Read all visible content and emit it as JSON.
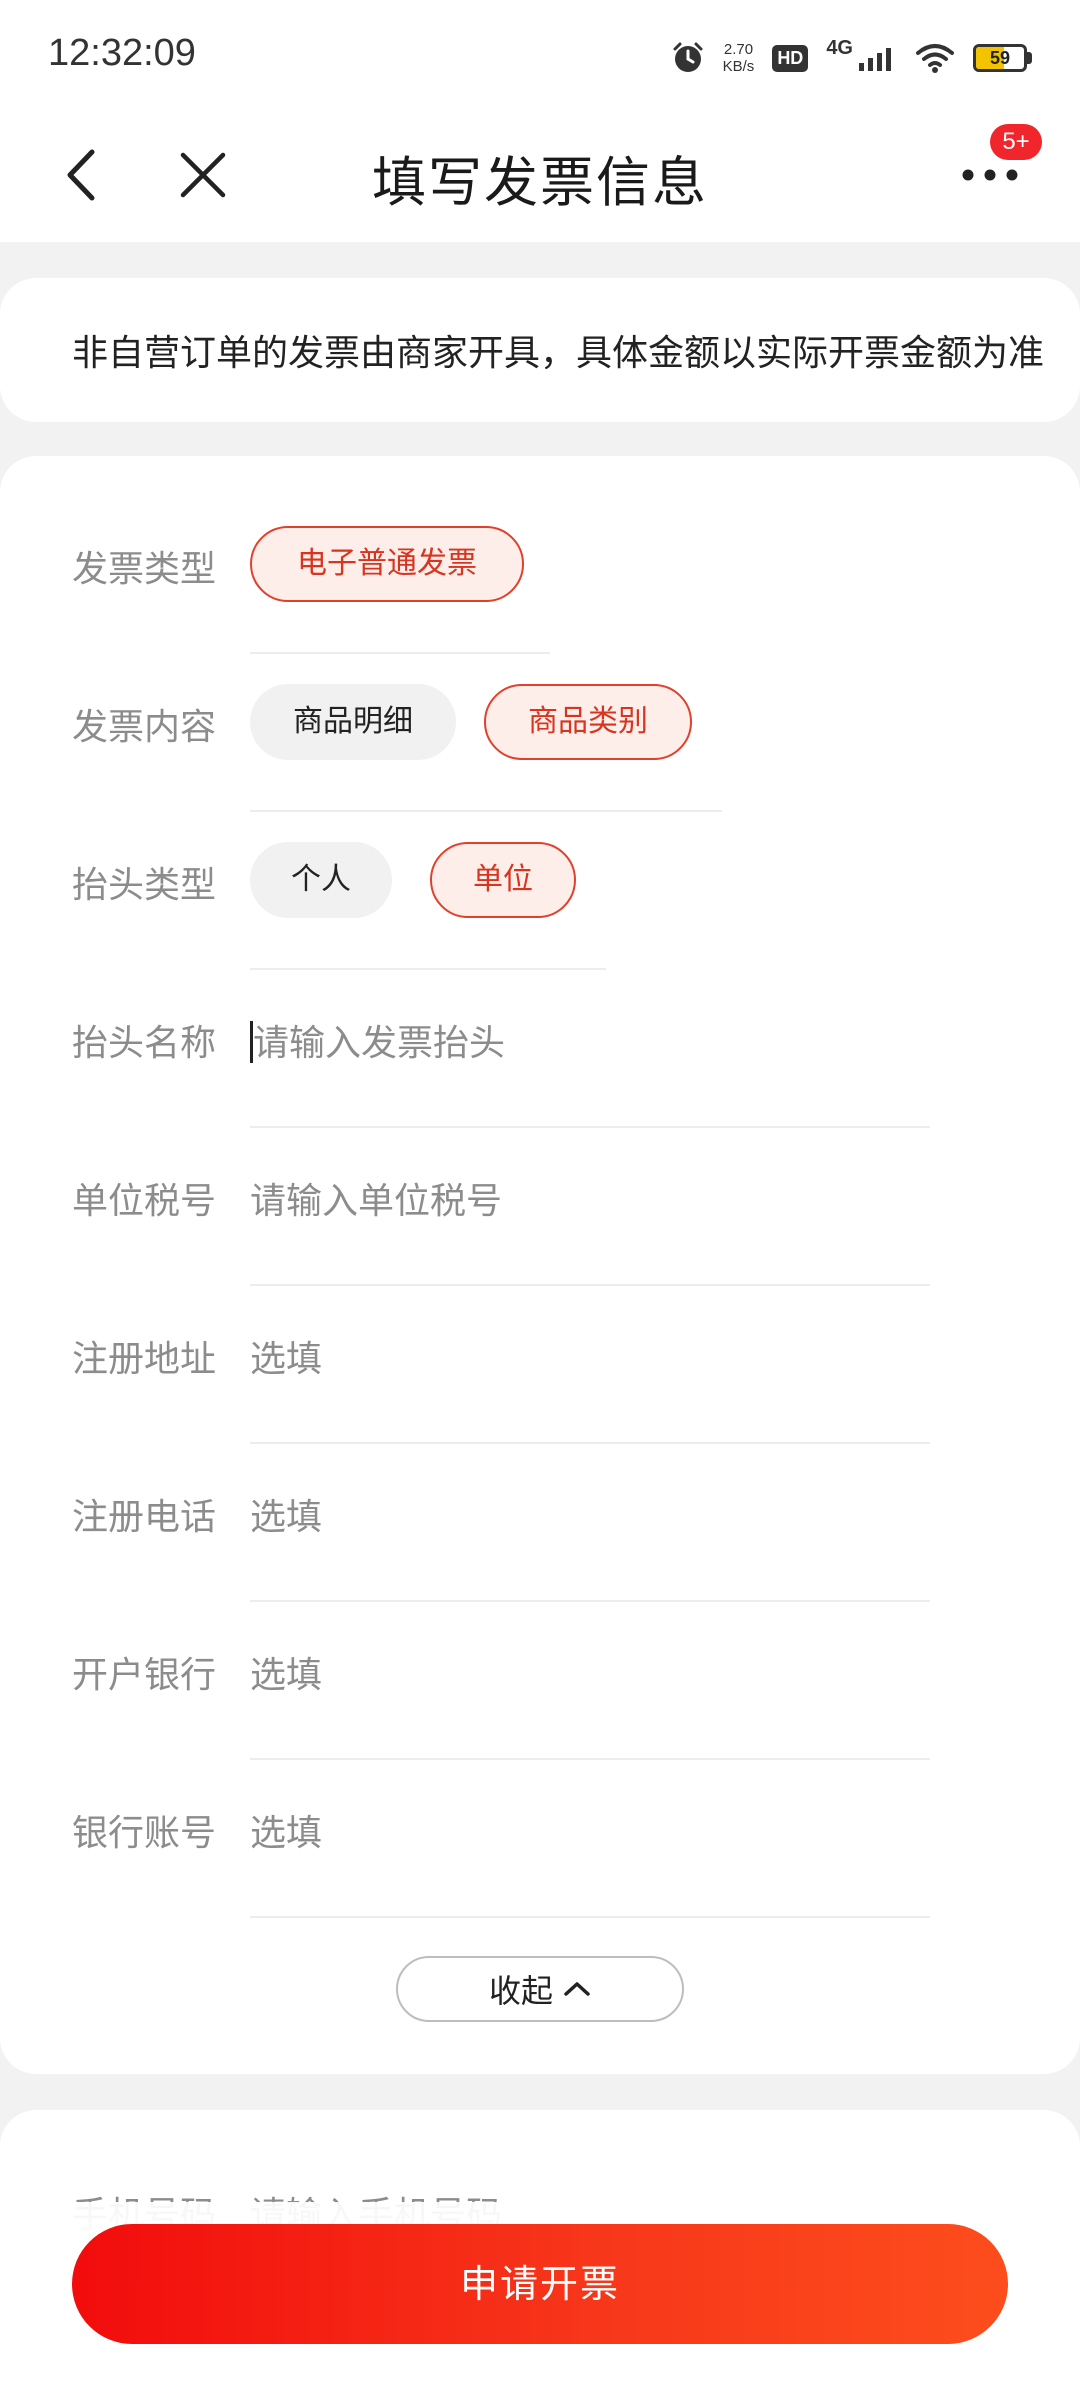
{
  "status_bar": {
    "time": "12:32:09",
    "speed_value": "2.70",
    "speed_unit": "KB/s",
    "hd": "HD",
    "network": "4G",
    "battery": "59",
    "battery_level": 0.59,
    "battery_color": "#f2c400"
  },
  "nav": {
    "title": "填写发票信息",
    "badge": "5+",
    "back_icon": "chevron-left",
    "close_icon": "close-x",
    "more_icon": "more-dots"
  },
  "notice": "非自营订单的发票由商家开具，具体金额以实际开票金额为准",
  "form": {
    "invoice_type": {
      "label": "发票类型",
      "options": [
        "电子普通发票"
      ],
      "selected": "电子普通发票"
    },
    "invoice_content": {
      "label": "发票内容",
      "options": [
        "商品明细",
        "商品类别"
      ],
      "selected": "商品类别"
    },
    "header_type": {
      "label": "抬头类型",
      "options": [
        "个人",
        "单位"
      ],
      "selected": "单位"
    },
    "header_name": {
      "label": "抬头名称",
      "placeholder": "请输入发票抬头"
    },
    "tax_id": {
      "label": "单位税号",
      "placeholder": "请输入单位税号"
    },
    "reg_address": {
      "label": "注册地址",
      "placeholder": "选填"
    },
    "reg_phone": {
      "label": "注册电话",
      "placeholder": "选填"
    },
    "bank": {
      "label": "开户银行",
      "placeholder": "选填"
    },
    "bank_account": {
      "label": "银行账号",
      "placeholder": "选填"
    },
    "collapse_label": "收起"
  },
  "contact": {
    "phone_label": "手机号码",
    "phone_placeholder": "请输入手机号码"
  },
  "submit_label": "申请开票",
  "colors": {
    "accent": "#e1402b",
    "accent_bg": "#fdeeea",
    "button_start": "#f20c0c",
    "button_end": "#fd4d1c",
    "badge": "#f0262c"
  }
}
